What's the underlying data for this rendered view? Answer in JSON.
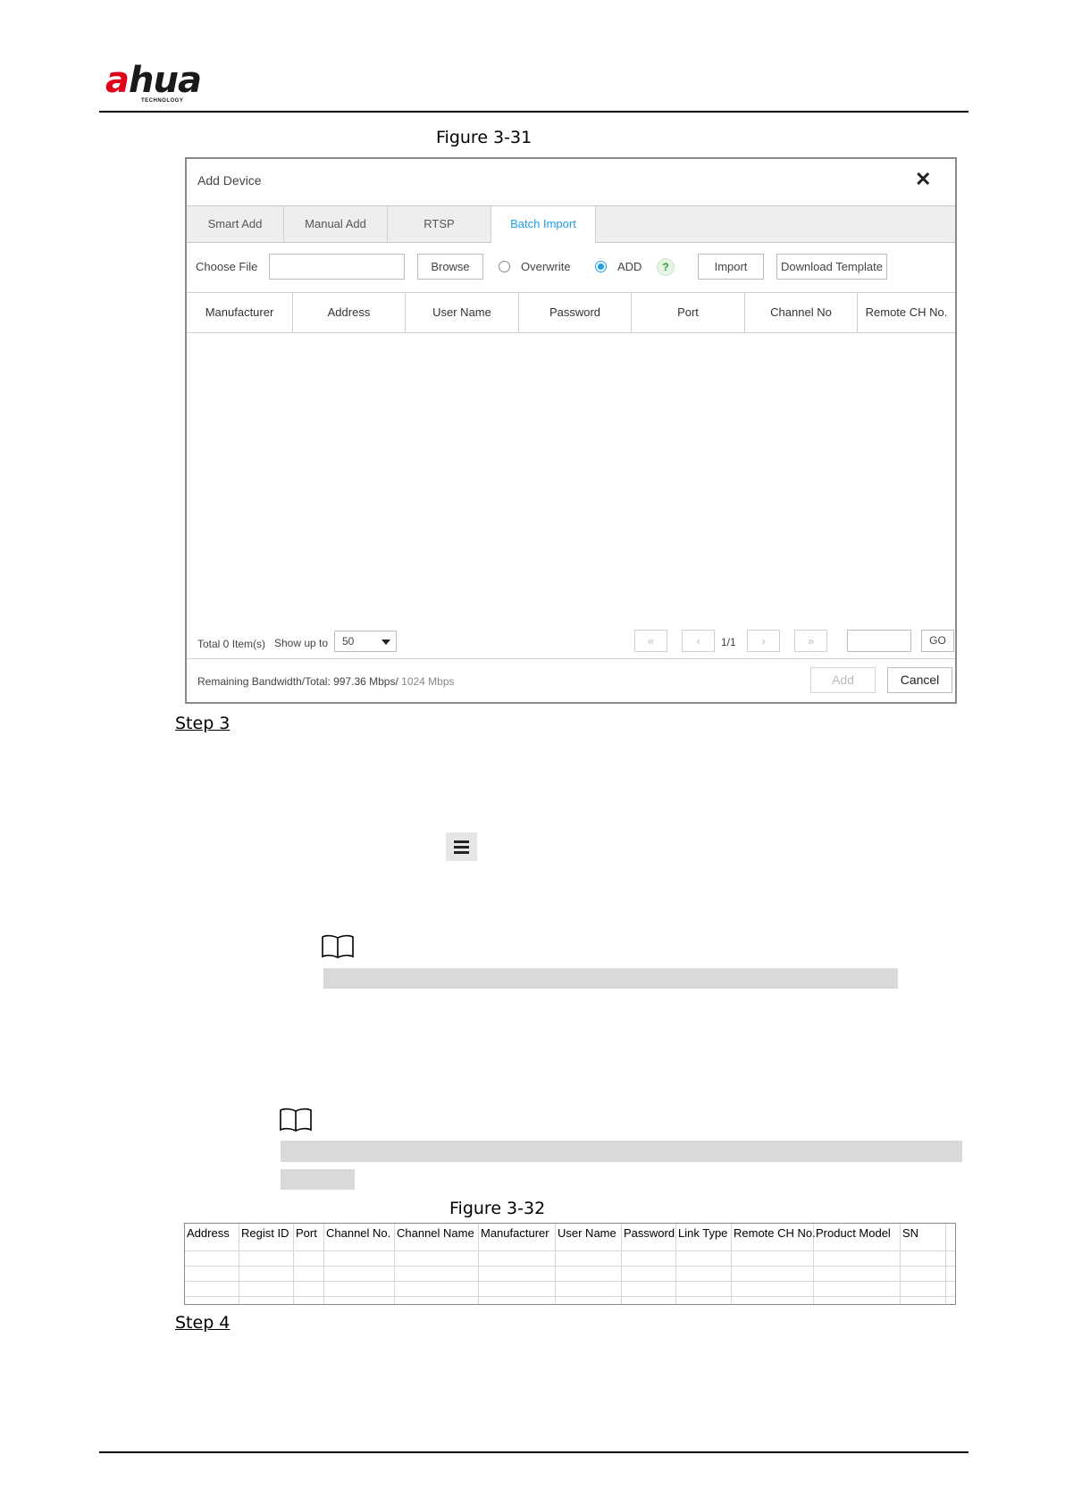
{
  "header": {
    "logo_text_left": "a",
    "logo_text_right": "hua",
    "logo_sub": "TECHNOLOGY"
  },
  "figure1": {
    "caption": "Figure 3-31"
  },
  "dialog": {
    "title": "Add Device",
    "close_icon": "close-icon",
    "tabs": [
      {
        "label": "Smart Add",
        "active": false
      },
      {
        "label": "Manual Add",
        "active": false
      },
      {
        "label": "RTSP",
        "active": false
      },
      {
        "label": "Batch Import",
        "active": true
      }
    ],
    "choose_file_label": "Choose File",
    "file_value": "",
    "browse_label": "Browse",
    "overwrite_label": "Overwrite",
    "add_label": "ADD",
    "help_icon": "help-icon",
    "import_label": "Import",
    "download_template_label": "Download Template",
    "selected_mode": "ADD",
    "columns": [
      "Manufacturer",
      "Address",
      "User Name",
      "Password",
      "Port",
      "Channel No",
      "Remote CH No."
    ],
    "rows": [],
    "total_label": "Total 0 Item(s)",
    "show_up_to_label": "Show up to",
    "page_size": "50",
    "page_indicator": "1/1",
    "go_label": "GO",
    "bandwidth_label": "Remaining Bandwidth/Total: 997.36 Mbps/",
    "bandwidth_total": "1024 Mbps",
    "add_button": "Add",
    "cancel_button": "Cancel",
    "colors": {
      "accent": "#1e9fe6"
    }
  },
  "steps": {
    "step3": "Step 3",
    "step4": "Step 4"
  },
  "figure2": {
    "caption": "Figure 3-32",
    "columns": [
      "Address",
      "Regist ID",
      "Port",
      "Channel No.",
      "Channel Name",
      "Manufacturer",
      "User Name",
      "Password",
      "Link Type",
      "Remote CH No.",
      "Product Model",
      "SN"
    ]
  }
}
